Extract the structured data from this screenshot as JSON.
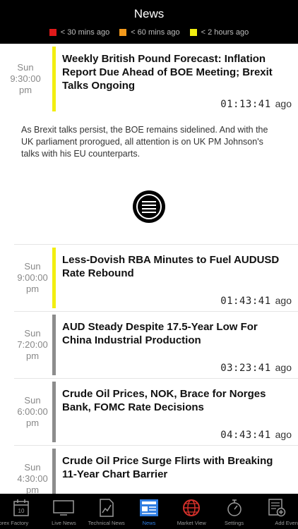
{
  "header": {
    "title": "News",
    "legend": [
      {
        "color": "#e01a1a",
        "label": "< 30 mins ago"
      },
      {
        "color": "#f39a1c",
        "label": "< 60 mins ago"
      },
      {
        "color": "#f2ee10",
        "label": "< 2 hours ago"
      }
    ]
  },
  "items": [
    {
      "day": "Sun",
      "time": "9:30:00",
      "ampm": "pm",
      "bar_color": "#f2ee10",
      "headline": "Weekly British Pound Forecast: Inflation Report Due Ahead of BOE Meeting; Brexit Talks Ongoing",
      "elapsed": "01:13:41",
      "ago": "ago",
      "summary": "As Brexit talks persist, the BOE remains sidelined. And with the UK parliament prorogued, all attention is on UK PM Johnson's talks with his EU counterparts."
    },
    {
      "day": "Sun",
      "time": "9:00:00",
      "ampm": "pm",
      "bar_color": "#f2ee10",
      "headline": "Less-Dovish RBA Minutes to Fuel AUDUSD Rate Rebound",
      "elapsed": "01:43:41",
      "ago": "ago"
    },
    {
      "day": "Sun",
      "time": "7:20:00",
      "ampm": "pm",
      "bar_color": "#8c8c8c",
      "headline": "AUD Steady Despite 17.5-Year Low For China Industrial Production",
      "elapsed": "03:23:41",
      "ago": "ago"
    },
    {
      "day": "Sun",
      "time": "6:00:00",
      "ampm": "pm",
      "bar_color": "#8c8c8c",
      "headline": "Crude Oil Prices, NOK, Brace for Norges Bank, FOMC Rate Decisions",
      "elapsed": "04:43:41",
      "ago": "ago"
    },
    {
      "day": "Sun",
      "time": "4:30:00",
      "ampm": "pm",
      "bar_color": "#8c8c8c",
      "headline": "Crude Oil Price Surge Flirts with Breaking 11-Year Chart Barrier",
      "elapsed": "",
      "ago": ""
    }
  ],
  "tabs": [
    {
      "label": "Forex Factory",
      "icon": "calendar-icon",
      "calendar_day": "10",
      "active": false
    },
    {
      "label": "Live News",
      "icon": "monitor-icon",
      "active": false
    },
    {
      "label": "Technical News",
      "icon": "chart-icon",
      "active": false
    },
    {
      "label": "News",
      "icon": "newspaper-icon",
      "active": true
    },
    {
      "label": "Market View",
      "icon": "globe-icon",
      "active": false
    },
    {
      "label": "Settings",
      "icon": "stopwatch-icon",
      "active": false
    },
    {
      "label": "Add Event",
      "icon": "add-event-icon",
      "active": false
    }
  ],
  "colors": {
    "active_tab": "#2f7de1",
    "inactive_tab": "#9a9a9a",
    "header_bg": "#000000"
  }
}
